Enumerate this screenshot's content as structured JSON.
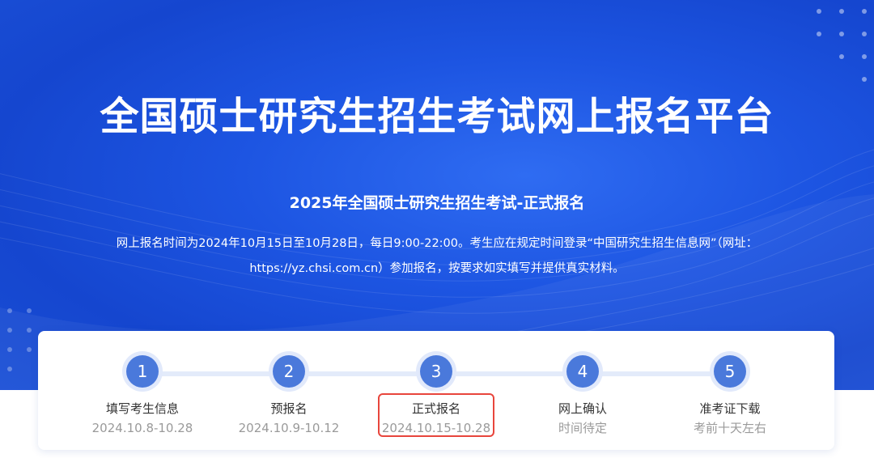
{
  "hero": {
    "title": "全国硕士研究生招生考试网上报名平台",
    "subtitle": "2025年全国硕士研究生招生考试-正式报名",
    "description_line1": "网上报名时间为2024年10月15日至10月28日，每日9:00-22:00。考生应在规定时间登录“中国研究生招生信息网”（网址：",
    "description_line2": "https://yz.chsi.com.cn）参加报名，按要求如实填写并提供真实材料。"
  },
  "steps": [
    {
      "number": "1",
      "label": "填写考生信息",
      "date": "2024.10.8-10.28"
    },
    {
      "number": "2",
      "label": "预报名",
      "date": "2024.10.9-10.12"
    },
    {
      "number": "3",
      "label": "正式报名",
      "date": "2024.10.15-10.28"
    },
    {
      "number": "4",
      "label": "网上确认",
      "date": "时间待定"
    },
    {
      "number": "5",
      "label": "准考证下载",
      "date": "考前十天左右"
    }
  ],
  "highlighted_step": "3",
  "colors": {
    "hero_blue": "#1d55e2",
    "step_circle": "#4a79db",
    "highlight_border": "#e8453c"
  }
}
